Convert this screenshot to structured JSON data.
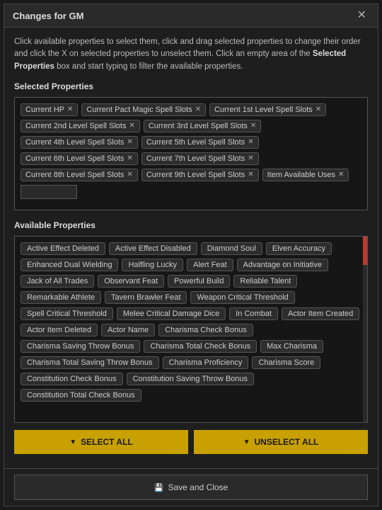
{
  "modal": {
    "title": "Changes for GM",
    "close_label": "✕"
  },
  "instructions": {
    "text_plain": "Click available properties to select them, click and drag selected properties to change their order and click the X on selected properties to unselect them. Click an empty area of the ",
    "text_bold": "Selected Properties",
    "text_end": " box and start typing to filter the available properties."
  },
  "selected_section": {
    "label": "Selected Properties",
    "tags": [
      {
        "label": "Current HP",
        "id": "current-hp"
      },
      {
        "label": "Current Pact Magic Spell Slots",
        "id": "pact-slots"
      },
      {
        "label": "Current 1st Level Spell Slots",
        "id": "1st-slots"
      },
      {
        "label": "Current 2nd Level Spell Slots",
        "id": "2nd-slots"
      },
      {
        "label": "Current 3rd Level Spell Slots",
        "id": "3rd-slots"
      },
      {
        "label": "Current 4th Level Spell Slots",
        "id": "4th-slots"
      },
      {
        "label": "Current 5th Level Spell Slots",
        "id": "5th-slots"
      },
      {
        "label": "Current 6th Level Spell Slots",
        "id": "6th-slots"
      },
      {
        "label": "Current 7th Level Spell Slots",
        "id": "7th-slots"
      },
      {
        "label": "Current 8th Level Spell Slots",
        "id": "8th-slots"
      },
      {
        "label": "Current 9th Level Spell Slots",
        "id": "9th-slots"
      },
      {
        "label": "Item Available Uses",
        "id": "item-uses"
      }
    ],
    "filter_placeholder": ""
  },
  "available_section": {
    "label": "Available Properties",
    "tags": [
      "Active Effect Deleted",
      "Active Effect Disabled",
      "Diamond Soul",
      "Elven Accuracy",
      "Enhanced Dual Wielding",
      "Halfling Lucky",
      "Alert Feat",
      "Advantage on Initiative",
      "Jack of All Trades",
      "Observant Feat",
      "Powerful Build",
      "Reliable Talent",
      "Remarkable Athlete",
      "Tavern Brawler Feat",
      "Weapon Critical Threshold",
      "Spell Critical Threshold",
      "Melee Critical Damage Dice",
      "In Combat",
      "Actor Item Created",
      "Actor Item Deleted",
      "Actor Name",
      "Charisma Check Bonus",
      "Charisma Saving Throw Bonus",
      "Charisma Total Check Bonus",
      "Max Charisma",
      "Charisma Total Saving Throw Bonus",
      "Charisma Proficiency",
      "Charisma Score",
      "Constitution Check Bonus",
      "Constitution Saving Throw Bonus",
      "Constitution Total Check Bonus"
    ]
  },
  "buttons": {
    "select_all": "SELECT ALL",
    "unselect_all": "UNSELECT ALL",
    "save_close": "Save and Close",
    "filter_icon": "▼",
    "unselect_icon": "▼",
    "save_icon": "💾"
  }
}
